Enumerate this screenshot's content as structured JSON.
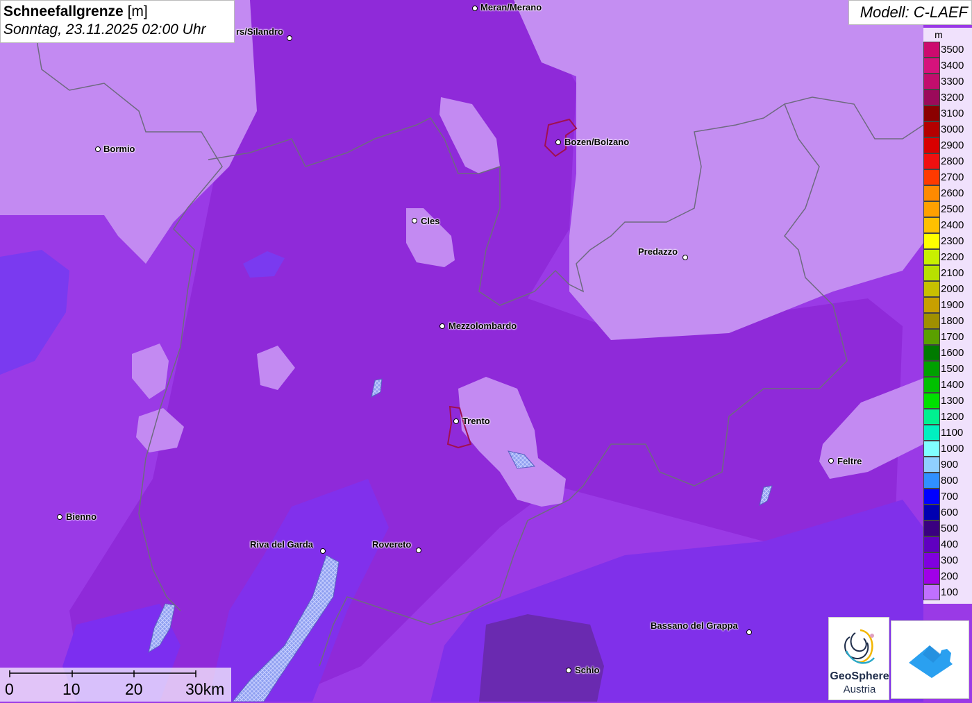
{
  "header": {
    "title": "Schneefallgrenze",
    "unit": "[m]",
    "datetime": "Sonntag, 23.11.2025 02:00 Uhr"
  },
  "model": "Modell: C-LAEF",
  "legend": {
    "unit": "m",
    "entries": [
      {
        "label": "3500",
        "color": "#cc0a6e"
      },
      {
        "label": "3400",
        "color": "#d6127c"
      },
      {
        "label": "3300",
        "color": "#c20d6d"
      },
      {
        "label": "3200",
        "color": "#9b0a5a"
      },
      {
        "label": "3100",
        "color": "#8b0000"
      },
      {
        "label": "3000",
        "color": "#b40000"
      },
      {
        "label": "2900",
        "color": "#d80000"
      },
      {
        "label": "2800",
        "color": "#f01010"
      },
      {
        "label": "2700",
        "color": "#ff3a00"
      },
      {
        "label": "2600",
        "color": "#ff8a00"
      },
      {
        "label": "2500",
        "color": "#ffa000"
      },
      {
        "label": "2400",
        "color": "#ffc000"
      },
      {
        "label": "2300",
        "color": "#ffff00"
      },
      {
        "label": "2200",
        "color": "#c8f000"
      },
      {
        "label": "2100",
        "color": "#b8e000"
      },
      {
        "label": "2000",
        "color": "#c8c000"
      },
      {
        "label": "1900",
        "color": "#c8a000"
      },
      {
        "label": "1800",
        "color": "#a09000"
      },
      {
        "label": "1700",
        "color": "#5aa000"
      },
      {
        "label": "1600",
        "color": "#007a00"
      },
      {
        "label": "1500",
        "color": "#00a000"
      },
      {
        "label": "1400",
        "color": "#00c000"
      },
      {
        "label": "1300",
        "color": "#00e000"
      },
      {
        "label": "1200",
        "color": "#00f090"
      },
      {
        "label": "1100",
        "color": "#00f0c0"
      },
      {
        "label": "1000",
        "color": "#80ffff"
      },
      {
        "label": "900",
        "color": "#90d0ff"
      },
      {
        "label": "800",
        "color": "#3090ff"
      },
      {
        "label": "700",
        "color": "#0000ff"
      },
      {
        "label": "600",
        "color": "#0000b0"
      },
      {
        "label": "500",
        "color": "#3a0080"
      },
      {
        "label": "400",
        "color": "#6000c0"
      },
      {
        "label": "300",
        "color": "#8000e0"
      },
      {
        "label": "200",
        "color": "#a000e8"
      },
      {
        "label": "100",
        "color": "#c070ff"
      }
    ]
  },
  "cities": [
    {
      "name": "Meran/Merano"
    },
    {
      "name": "rs/Silandro"
    },
    {
      "name": "Bormio"
    },
    {
      "name": "Bozen/Bolzano"
    },
    {
      "name": "Cles"
    },
    {
      "name": "Predazzo"
    },
    {
      "name": "Mezzolombardo"
    },
    {
      "name": "Trento"
    },
    {
      "name": "Feltre"
    },
    {
      "name": "Bienno"
    },
    {
      "name": "Riva del Garda"
    },
    {
      "name": "Rovereto"
    },
    {
      "name": "Bassano del Grappa"
    },
    {
      "name": "Schio"
    }
  ],
  "scalebar": {
    "labels": [
      "0",
      "10",
      "20",
      "30km"
    ]
  },
  "logo": {
    "line1": "GeoSphere",
    "line2": "Austria"
  },
  "colors": {
    "base": "#9a3ae6",
    "light": "#c78cf2",
    "dark": "#8a22d6",
    "blue": "#7a3af0",
    "border": "#6a6a7a"
  }
}
